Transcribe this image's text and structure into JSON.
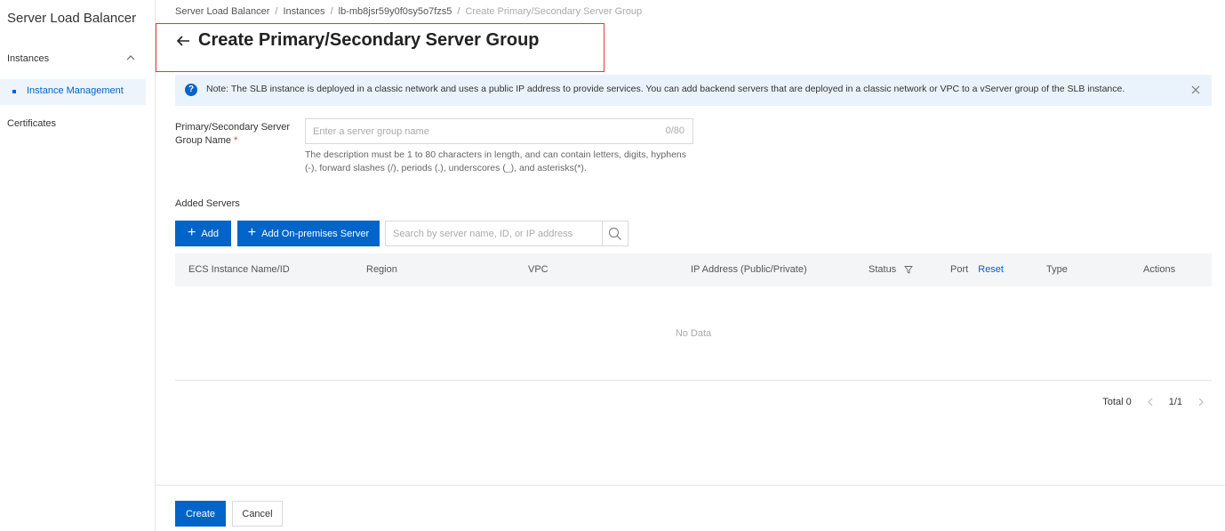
{
  "sidebar": {
    "product_title": "Server Load Balancer",
    "group_label": "Instances",
    "active_item": "Instance Management",
    "item_certificates": "Certificates"
  },
  "breadcrumb": {
    "items": [
      "Server Load Balancer",
      "Instances",
      "lb-mb8jsr59y0f0sy5o7fzs5"
    ],
    "current": "Create Primary/Secondary Server Group",
    "separator": "/"
  },
  "page": {
    "title": "Create Primary/Secondary Server Group"
  },
  "notice": {
    "text": "Note: The SLB instance is deployed in a classic network and uses a public IP address to provide services. You can add backend servers that are deployed in a classic network or VPC to a vServer group of the SLB instance."
  },
  "form": {
    "name_label": "Primary/Secondary Server Group Name",
    "required_mark": "*",
    "name_placeholder": "Enter a server group name",
    "name_value": "",
    "name_count": "0/80",
    "hint": "The description must be 1 to 80 characters in length, and can contain letters, digits, hyphens (-), forward slashes (/), periods (.), underscores (_), and asterisks(*)."
  },
  "servers": {
    "section_title": "Added Servers",
    "add_label": "Add",
    "add_onprem_label": "Add On-premises Server",
    "search_placeholder": "Search by server name, ID, or IP address",
    "columns": {
      "name": "ECS Instance Name/ID",
      "region": "Region",
      "vpc": "VPC",
      "ip": "IP Address (Public/Private)",
      "status": "Status",
      "port": "Port",
      "reset": "Reset",
      "type": "Type",
      "actions": "Actions"
    },
    "empty_text": "No Data"
  },
  "pagination": {
    "total": "Total 0",
    "page": "1/1"
  },
  "footer": {
    "create_label": "Create",
    "cancel_label": "Cancel"
  },
  "colors": {
    "primary": "#0064c8",
    "highlight_border": "#e23b3b",
    "notice_bg": "#eaf3fc"
  }
}
